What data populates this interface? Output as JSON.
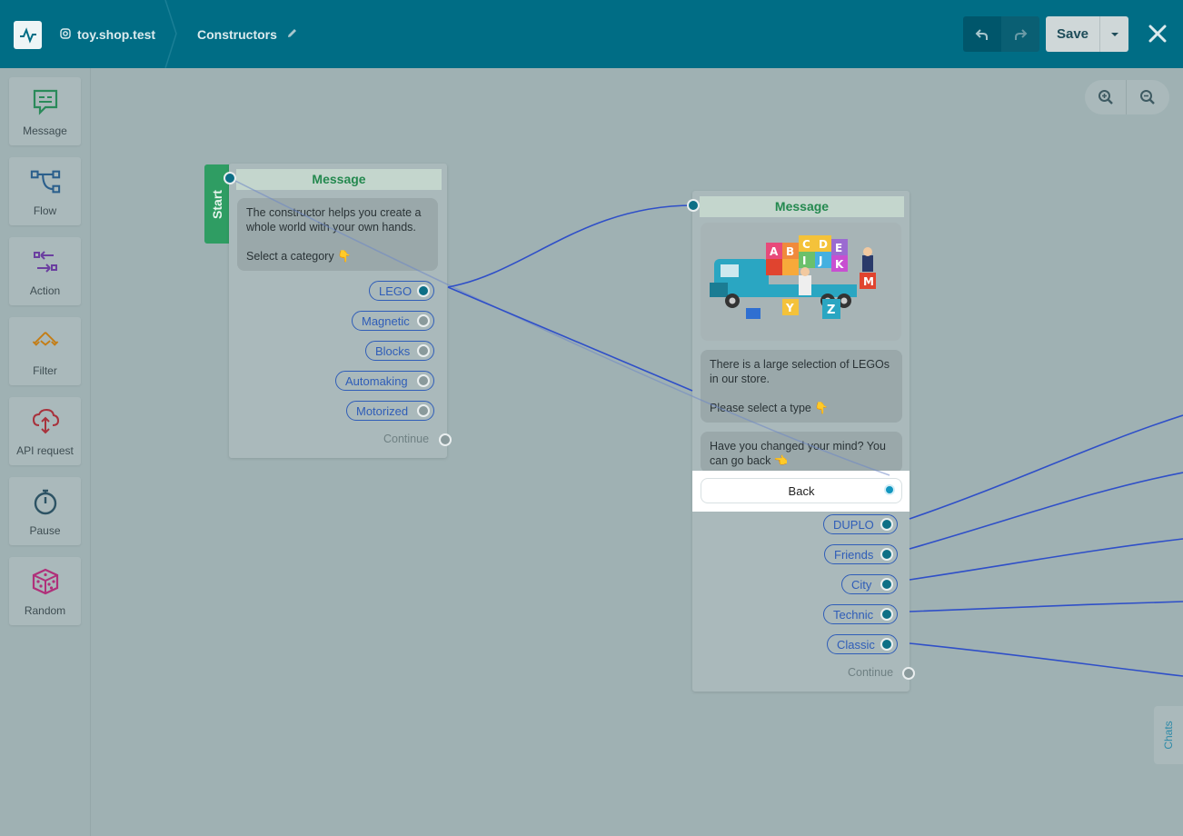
{
  "header": {
    "account": "toy.shop.test",
    "title": "Constructors",
    "save_label": "Save"
  },
  "sidebar": {
    "items": [
      {
        "label": "Message",
        "icon": "message-icon"
      },
      {
        "label": "Flow",
        "icon": "flow-icon"
      },
      {
        "label": "Action",
        "icon": "action-icon"
      },
      {
        "label": "Filter",
        "icon": "filter-icon"
      },
      {
        "label": "API request",
        "icon": "api-request-icon"
      },
      {
        "label": "Pause",
        "icon": "pause-icon"
      },
      {
        "label": "Random",
        "icon": "random-icon"
      }
    ]
  },
  "start_label": "Start",
  "node1": {
    "title": "Message",
    "text_line1": "The constructor helps you create a",
    "text_line2": "whole world with your own hands.",
    "text_line3": "Select a category",
    "text_emoji": "👇",
    "buttons": [
      "LEGO",
      "Magnetic",
      "Blocks",
      "Automaking",
      "Motorized"
    ],
    "continue": "Continue"
  },
  "node2": {
    "title": "Message",
    "text1_line1": "There is a large selection of LEGOs",
    "text1_line2": "in our store.",
    "text1_line3": "Please select a type",
    "text1_emoji": "👇",
    "text2_line1": "Have you changed your mind? You",
    "text2_line2": "can go back",
    "text2_emoji": "👈",
    "back_label": "Back",
    "buttons": [
      "DUPLO",
      "Friends",
      "City",
      "Technic",
      "Classic"
    ],
    "continue": "Continue"
  },
  "chats_label": "Chats",
  "colors": {
    "header": "#006d85",
    "canvas": "#9fb1b3",
    "accent_green": "#2f9d63",
    "wire": "#2f4fc8"
  }
}
